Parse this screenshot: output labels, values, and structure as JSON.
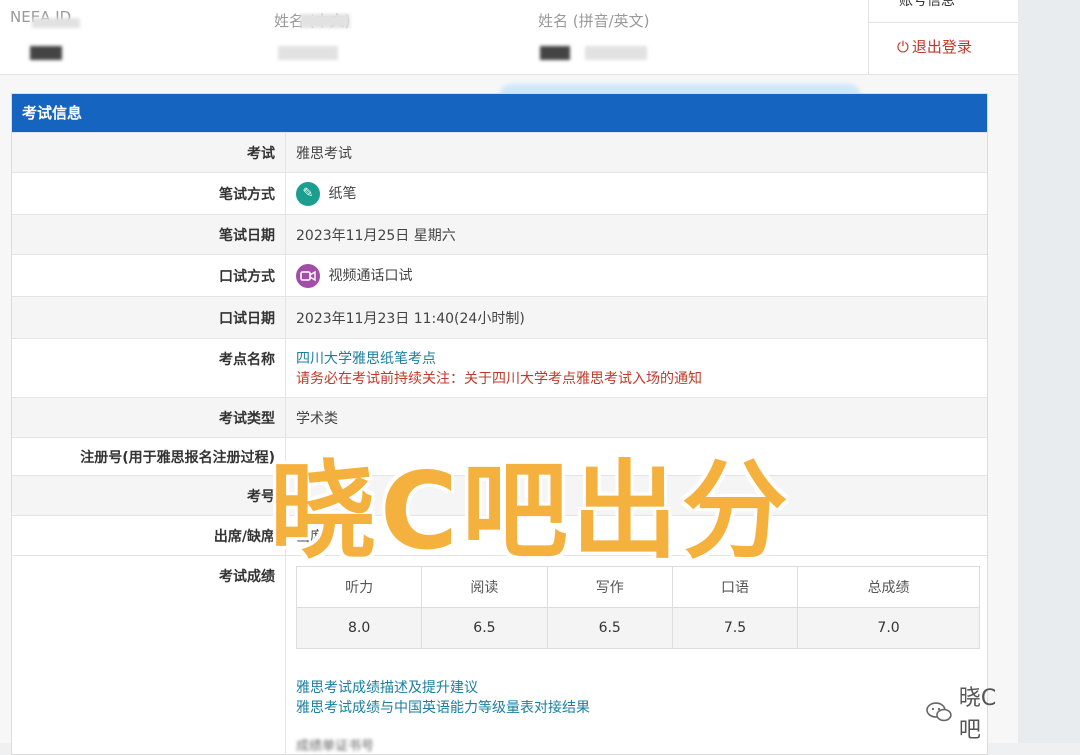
{
  "header": {
    "id_label": "NEEA ID",
    "name_label": "姓名 (中文)",
    "name_en_label": "姓名 (拼音/英文)"
  },
  "user_menu": {
    "account": "账号信息",
    "logout": "退出登录"
  },
  "panel": {
    "title": "考试信息",
    "rows": [
      {
        "label": "考试",
        "value": "雅思考试"
      },
      {
        "label": "笔试方式",
        "value": "纸笔"
      },
      {
        "label": "笔试日期",
        "value": "2023年11月25日 星期六"
      },
      {
        "label": "口试方式",
        "value": "视频通话口试"
      },
      {
        "label": "口试日期",
        "value": "2023年11月23日 11:40(24小时制)"
      },
      {
        "label": "考点名称",
        "value": "四川大学雅思纸笔考点",
        "notice": "请务必在考试前持续关注：关于四川大学考点雅思考试入场的通知"
      },
      {
        "label": "考试类型",
        "value": "学术类"
      },
      {
        "label": "注册号(用于雅思报名注册过程)",
        "value": ""
      },
      {
        "label": "考号",
        "value": ""
      },
      {
        "label": "出席/缺席",
        "value": "出席"
      },
      {
        "label": "考试成绩",
        "value": ""
      }
    ]
  },
  "scores": {
    "headers": [
      "听力",
      "阅读",
      "写作",
      "口语",
      "总成绩"
    ],
    "values": [
      "8.0",
      "6.5",
      "6.5",
      "7.5",
      "7.0"
    ]
  },
  "links": {
    "desc": "雅思考试成绩描述及提升建议",
    "cse": "雅思考试成绩与中国英语能力等级量表对接结果",
    "report": "成绩单证书号"
  },
  "icons": {
    "write_mode": "pencil-icon",
    "speak_mode": "video-camera-icon",
    "logout": "power-icon"
  },
  "watermark": "晓C吧出分",
  "wechat_label": "晓C吧",
  "colors": {
    "panel_header": "#1565c0",
    "notice": "#c0392b",
    "link": "#1a7fa0",
    "watermark": "#f5b13d"
  }
}
